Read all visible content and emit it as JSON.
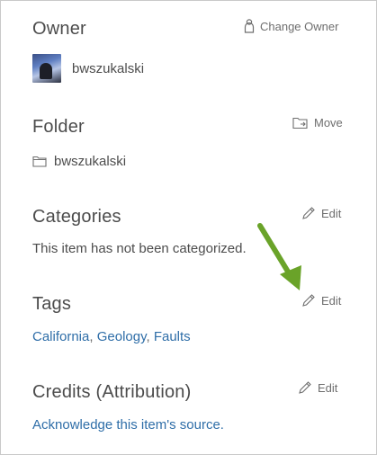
{
  "owner": {
    "title": "Owner",
    "action_label": "Change Owner",
    "username": "bwszukalski"
  },
  "folder": {
    "title": "Folder",
    "action_label": "Move",
    "name": "bwszukalski"
  },
  "categories": {
    "title": "Categories",
    "action_label": "Edit",
    "text": "This item has not been categorized."
  },
  "tags": {
    "title": "Tags",
    "action_label": "Edit",
    "items": [
      "California",
      "Geology",
      "Faults"
    ],
    "separator": ", "
  },
  "credits": {
    "title": "Credits (Attribution)",
    "action_label": "Edit",
    "link": "Acknowledge this item's source."
  },
  "icons": {
    "change_owner": "person-icon",
    "move": "move-folder-icon",
    "folder": "folder-icon",
    "edit": "pencil-icon",
    "annotation": "green-arrow"
  },
  "colors": {
    "text": "#4c4c4c",
    "muted": "#6e6e6e",
    "link": "#2f6ea8",
    "arrow": "#6aa329",
    "border": "#c9c9c9"
  }
}
